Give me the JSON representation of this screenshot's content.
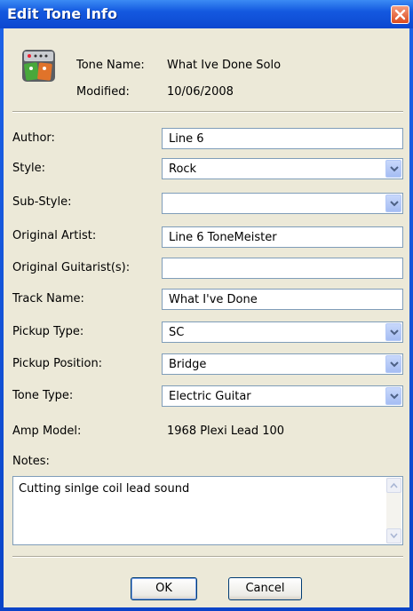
{
  "window": {
    "title": "Edit Tone Info"
  },
  "header": {
    "tone_name_label": "Tone Name:",
    "tone_name_value": "What Ive Done Solo",
    "modified_label": "Modified:",
    "modified_value": "10/06/2008"
  },
  "form": {
    "author": {
      "label": "Author:",
      "value": "Line 6"
    },
    "style": {
      "label": "Style:",
      "value": "Rock"
    },
    "sub_style": {
      "label": "Sub-Style:",
      "value": ""
    },
    "original_artist": {
      "label": "Original Artist:",
      "value": "Line 6 ToneMeister"
    },
    "original_guitarists": {
      "label": "Original Guitarist(s):",
      "value": ""
    },
    "track_name": {
      "label": "Track Name:",
      "value": "What I've Done"
    },
    "pickup_type": {
      "label": "Pickup Type:",
      "value": "SC"
    },
    "pickup_position": {
      "label": "Pickup Position:",
      "value": "Bridge"
    },
    "tone_type": {
      "label": "Tone Type:",
      "value": "Electric Guitar"
    },
    "amp_model": {
      "label": "Amp Model:",
      "value": "1968 Plexi Lead 100"
    },
    "notes": {
      "label": "Notes:",
      "value": "Cutting sinlge coil lead sound"
    }
  },
  "buttons": {
    "ok": "OK",
    "cancel": "Cancel"
  },
  "colors": {
    "titlebar": "#0c47cf",
    "client": "#ece9d8",
    "field_border": "#7f9db9",
    "close": "#db4b1e"
  },
  "icons": [
    "pedal-board-icon",
    "close-icon",
    "chevron-down-icon",
    "scroll-up-icon",
    "scroll-down-icon"
  ]
}
